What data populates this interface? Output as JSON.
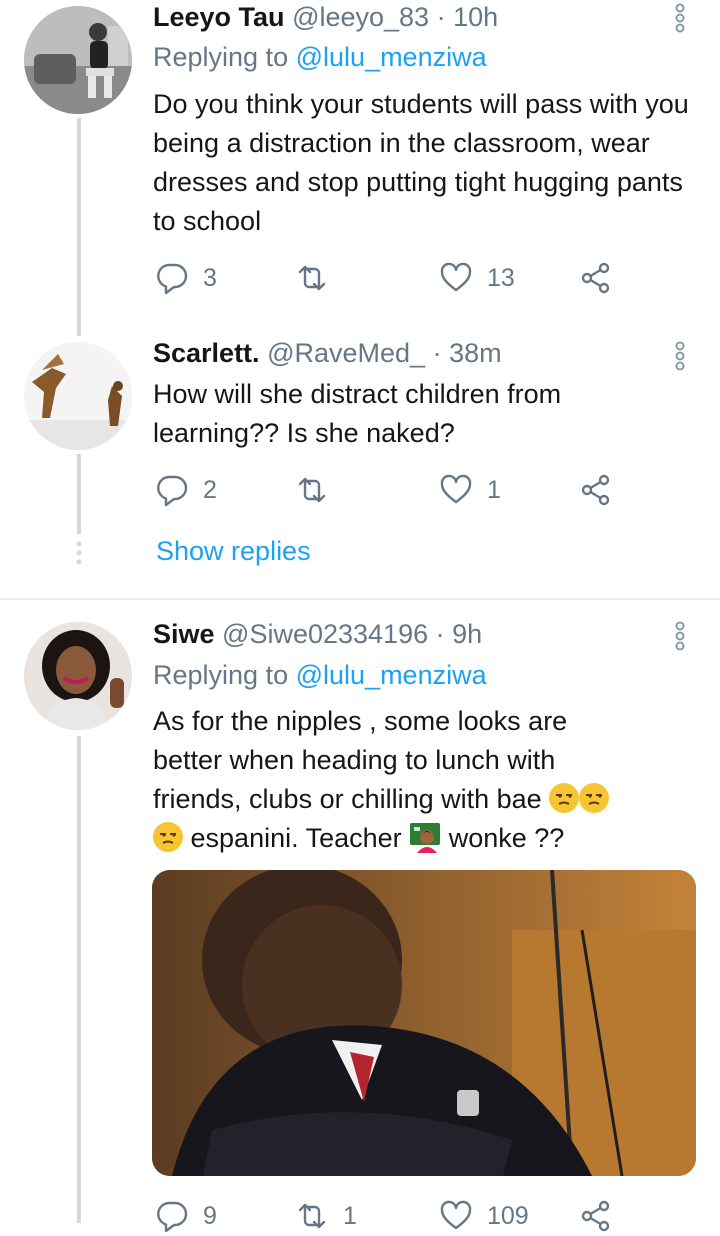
{
  "tweets": [
    {
      "name": "Leeyo Tau",
      "handle": "@leeyo_83",
      "sep": "·",
      "time": "10h",
      "replying_label": "Replying to",
      "replying_to": "@lulu_menziwa",
      "text": "Do you think your students will pass with you being a distraction in the classroom, wear dresses and stop putting tight hugging pants to school",
      "replies": "3",
      "retweets": "",
      "likes": "13"
    },
    {
      "name": "Scarlett.",
      "handle": "@RaveMed_",
      "sep": "·",
      "time": "38m",
      "text": "How will she distract children from learning?? Is she naked?",
      "replies": "2",
      "retweets": "",
      "likes": "1"
    },
    {
      "name": "Siwe",
      "handle": "@Siwe02334196",
      "sep": "·",
      "time": "9h",
      "replying_label": "Replying to",
      "replying_to": "@lulu_menziwa",
      "text_line1": "As for the nipples  , some looks are",
      "text_line2": "better when heading to lunch with",
      "text_line3": "friends,  clubs or chilling with bae",
      "text_line4a": "espanini.   Teacher",
      "text_line4b": "wonke ??",
      "replies": "9",
      "retweets": "1",
      "likes": "109"
    }
  ],
  "show_replies": "Show replies",
  "icons": {
    "reply": "reply-icon",
    "retweet": "retweet-icon",
    "like": "heart-icon",
    "share": "share-icon",
    "more": "more-options-icon",
    "emoji_unamused": "unamused-face-icon",
    "emoji_teacher": "woman-teacher-icon"
  },
  "colors": {
    "link": "#1da1f2",
    "secondary": "#657786",
    "thread_line": "#cfd9de"
  }
}
